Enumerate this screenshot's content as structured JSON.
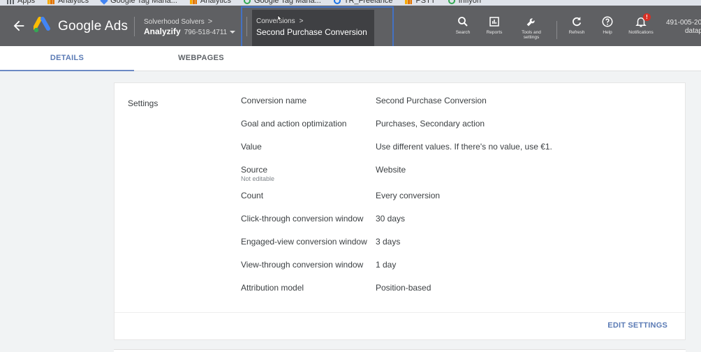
{
  "bookmarks": [
    {
      "label": "Apps",
      "icon": "apps-icon"
    },
    {
      "label": "Analytics",
      "icon": "analytics-icon"
    },
    {
      "label": "Google Tag Mana...",
      "icon": "tag-manager-icon"
    },
    {
      "label": "Analytics",
      "icon": "analytics-icon"
    },
    {
      "label": "Google Tag Mana...",
      "icon": "globe-icon"
    },
    {
      "label": "TR_Freelance",
      "icon": "circle-icon"
    },
    {
      "label": "PSTT",
      "icon": "analytics-icon"
    },
    {
      "label": "Inflyon",
      "icon": "globe-icon"
    }
  ],
  "header": {
    "brand": "Google Ads",
    "account_parent": "Solverhood Solvers",
    "account_name": "Analyzify",
    "account_id": "796-518-4711",
    "breadcrumb_parent": "Conversions",
    "breadcrumb_title": "Second Purchase Conversion",
    "buttons": [
      {
        "label": "Search",
        "icon": "search-icon"
      },
      {
        "label": "Reports",
        "icon": "reports-icon"
      },
      {
        "label": "Tools and settings",
        "icon": "wrench-icon"
      },
      {
        "label": "Refresh",
        "icon": "refresh-icon"
      },
      {
        "label": "Help",
        "icon": "help-icon"
      },
      {
        "label": "Notifications",
        "icon": "bell-icon",
        "badge": "!"
      }
    ],
    "customer_id": "491-005-20",
    "customer_name": "datap"
  },
  "tabs": [
    {
      "label": "DETAILS",
      "active": true
    },
    {
      "label": "WEBPAGES",
      "active": false
    }
  ],
  "settings": {
    "section_label": "Settings",
    "rows": [
      {
        "key": "Conversion name",
        "value": "Second Purchase Conversion"
      },
      {
        "key": "Goal and action optimization",
        "value": "Purchases, Secondary action"
      },
      {
        "key": "Value",
        "value": "Use different values. If there's no value, use €1."
      },
      {
        "key": "Source",
        "sub": "Not editable",
        "value": "Website"
      },
      {
        "key": "Count",
        "value": "Every conversion"
      },
      {
        "key": "Click-through conversion window",
        "value": "30 days"
      },
      {
        "key": "Engaged-view conversion window",
        "value": "3 days"
      },
      {
        "key": "View-through conversion window",
        "value": "1 day"
      },
      {
        "key": "Attribution model",
        "value": "Position-based"
      }
    ],
    "edit_button": "EDIT SETTINGS"
  },
  "colors": {
    "header_bg": "#5f6063",
    "accent": "#5b7bb5",
    "highlight_box": "#4472c4",
    "badge": "#d93025"
  }
}
